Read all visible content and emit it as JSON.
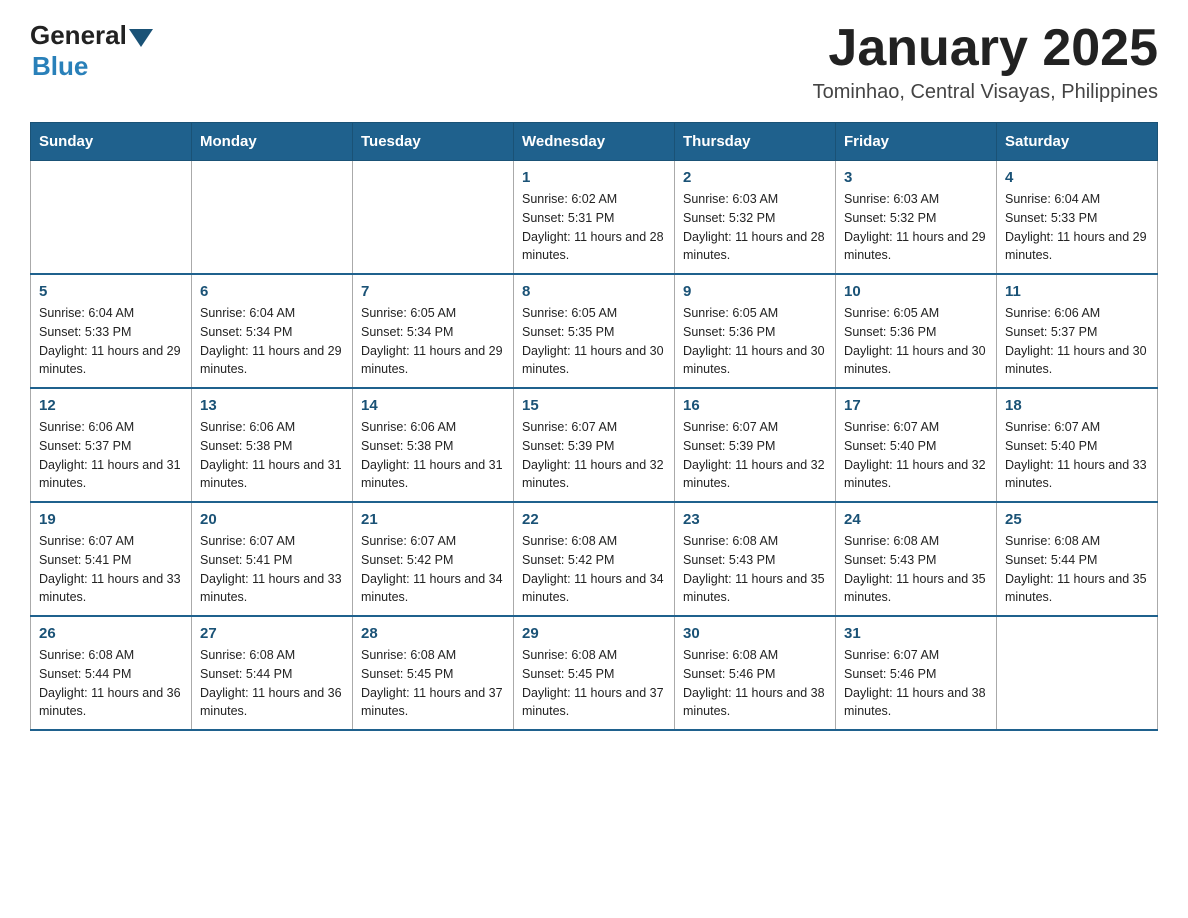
{
  "logo": {
    "general": "General",
    "blue": "Blue"
  },
  "title": "January 2025",
  "subtitle": "Tominhao, Central Visayas, Philippines",
  "headers": [
    "Sunday",
    "Monday",
    "Tuesday",
    "Wednesday",
    "Thursday",
    "Friday",
    "Saturday"
  ],
  "weeks": [
    [
      {
        "day": "",
        "info": ""
      },
      {
        "day": "",
        "info": ""
      },
      {
        "day": "",
        "info": ""
      },
      {
        "day": "1",
        "info": "Sunrise: 6:02 AM\nSunset: 5:31 PM\nDaylight: 11 hours and 28 minutes."
      },
      {
        "day": "2",
        "info": "Sunrise: 6:03 AM\nSunset: 5:32 PM\nDaylight: 11 hours and 28 minutes."
      },
      {
        "day": "3",
        "info": "Sunrise: 6:03 AM\nSunset: 5:32 PM\nDaylight: 11 hours and 29 minutes."
      },
      {
        "day": "4",
        "info": "Sunrise: 6:04 AM\nSunset: 5:33 PM\nDaylight: 11 hours and 29 minutes."
      }
    ],
    [
      {
        "day": "5",
        "info": "Sunrise: 6:04 AM\nSunset: 5:33 PM\nDaylight: 11 hours and 29 minutes."
      },
      {
        "day": "6",
        "info": "Sunrise: 6:04 AM\nSunset: 5:34 PM\nDaylight: 11 hours and 29 minutes."
      },
      {
        "day": "7",
        "info": "Sunrise: 6:05 AM\nSunset: 5:34 PM\nDaylight: 11 hours and 29 minutes."
      },
      {
        "day": "8",
        "info": "Sunrise: 6:05 AM\nSunset: 5:35 PM\nDaylight: 11 hours and 30 minutes."
      },
      {
        "day": "9",
        "info": "Sunrise: 6:05 AM\nSunset: 5:36 PM\nDaylight: 11 hours and 30 minutes."
      },
      {
        "day": "10",
        "info": "Sunrise: 6:05 AM\nSunset: 5:36 PM\nDaylight: 11 hours and 30 minutes."
      },
      {
        "day": "11",
        "info": "Sunrise: 6:06 AM\nSunset: 5:37 PM\nDaylight: 11 hours and 30 minutes."
      }
    ],
    [
      {
        "day": "12",
        "info": "Sunrise: 6:06 AM\nSunset: 5:37 PM\nDaylight: 11 hours and 31 minutes."
      },
      {
        "day": "13",
        "info": "Sunrise: 6:06 AM\nSunset: 5:38 PM\nDaylight: 11 hours and 31 minutes."
      },
      {
        "day": "14",
        "info": "Sunrise: 6:06 AM\nSunset: 5:38 PM\nDaylight: 11 hours and 31 minutes."
      },
      {
        "day": "15",
        "info": "Sunrise: 6:07 AM\nSunset: 5:39 PM\nDaylight: 11 hours and 32 minutes."
      },
      {
        "day": "16",
        "info": "Sunrise: 6:07 AM\nSunset: 5:39 PM\nDaylight: 11 hours and 32 minutes."
      },
      {
        "day": "17",
        "info": "Sunrise: 6:07 AM\nSunset: 5:40 PM\nDaylight: 11 hours and 32 minutes."
      },
      {
        "day": "18",
        "info": "Sunrise: 6:07 AM\nSunset: 5:40 PM\nDaylight: 11 hours and 33 minutes."
      }
    ],
    [
      {
        "day": "19",
        "info": "Sunrise: 6:07 AM\nSunset: 5:41 PM\nDaylight: 11 hours and 33 minutes."
      },
      {
        "day": "20",
        "info": "Sunrise: 6:07 AM\nSunset: 5:41 PM\nDaylight: 11 hours and 33 minutes."
      },
      {
        "day": "21",
        "info": "Sunrise: 6:07 AM\nSunset: 5:42 PM\nDaylight: 11 hours and 34 minutes."
      },
      {
        "day": "22",
        "info": "Sunrise: 6:08 AM\nSunset: 5:42 PM\nDaylight: 11 hours and 34 minutes."
      },
      {
        "day": "23",
        "info": "Sunrise: 6:08 AM\nSunset: 5:43 PM\nDaylight: 11 hours and 35 minutes."
      },
      {
        "day": "24",
        "info": "Sunrise: 6:08 AM\nSunset: 5:43 PM\nDaylight: 11 hours and 35 minutes."
      },
      {
        "day": "25",
        "info": "Sunrise: 6:08 AM\nSunset: 5:44 PM\nDaylight: 11 hours and 35 minutes."
      }
    ],
    [
      {
        "day": "26",
        "info": "Sunrise: 6:08 AM\nSunset: 5:44 PM\nDaylight: 11 hours and 36 minutes."
      },
      {
        "day": "27",
        "info": "Sunrise: 6:08 AM\nSunset: 5:44 PM\nDaylight: 11 hours and 36 minutes."
      },
      {
        "day": "28",
        "info": "Sunrise: 6:08 AM\nSunset: 5:45 PM\nDaylight: 11 hours and 37 minutes."
      },
      {
        "day": "29",
        "info": "Sunrise: 6:08 AM\nSunset: 5:45 PM\nDaylight: 11 hours and 37 minutes."
      },
      {
        "day": "30",
        "info": "Sunrise: 6:08 AM\nSunset: 5:46 PM\nDaylight: 11 hours and 38 minutes."
      },
      {
        "day": "31",
        "info": "Sunrise: 6:07 AM\nSunset: 5:46 PM\nDaylight: 11 hours and 38 minutes."
      },
      {
        "day": "",
        "info": ""
      }
    ]
  ]
}
